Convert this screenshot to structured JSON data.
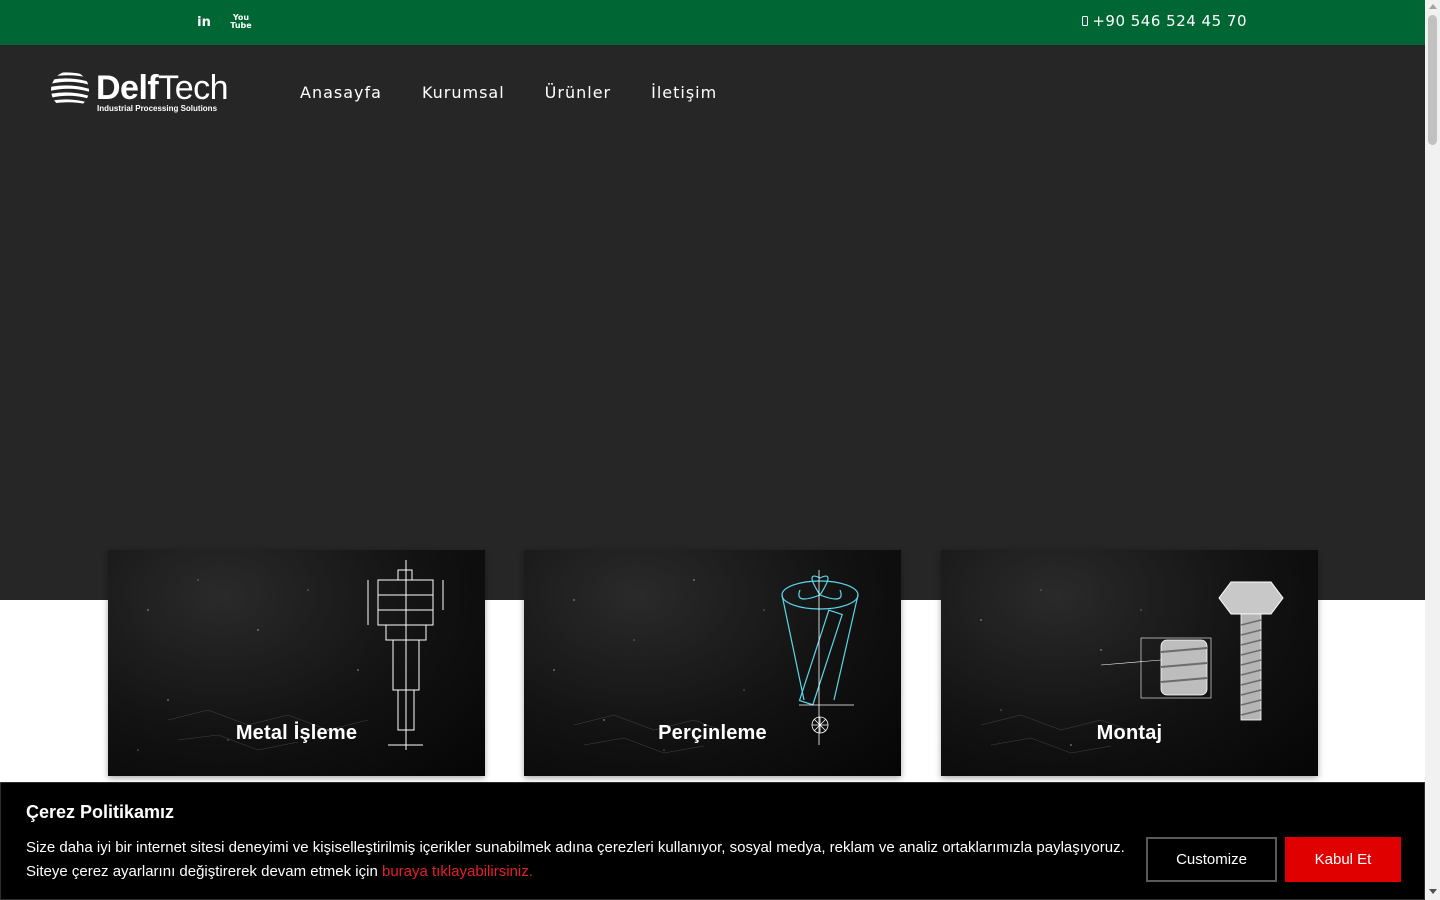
{
  "topbar": {
    "social": [
      {
        "name": "linkedin",
        "label": "in"
      },
      {
        "name": "youtube",
        "label_top": "You",
        "label_bottom": "Tube"
      }
    ],
    "phone": "+90 546 524 45 70"
  },
  "header": {
    "logo": {
      "bold": "Delf",
      "light": "Tech",
      "tagline": "Industrial Processing Solutions"
    },
    "nav": [
      "Anasayfa",
      "Kurumsal",
      "Ürünler",
      "İletişim"
    ]
  },
  "cards": [
    {
      "title": "Metal İşleme"
    },
    {
      "title": "Perçinleme"
    },
    {
      "title": "Montaj"
    }
  ],
  "cookie": {
    "title": "Çerez Politikamız",
    "text": "Size daha iyi bir internet sitesi deneyimi ve kişiselleştirilmiş içerikler sunabilmek adına çerezleri kullanıyor, sosyal medya, reklam ve analiz ortaklarımızla paylaşıyoruz. Siteye çerez ayarlarını değiştirerek devam etmek için",
    "link": "buraya tıklayabilirsiniz.",
    "customize": "Customize",
    "accept": "Kabul Et"
  },
  "colors": {
    "topbar": "#006634",
    "header": "#262626",
    "accept_button": "#e00000",
    "link": "#e3202a"
  }
}
